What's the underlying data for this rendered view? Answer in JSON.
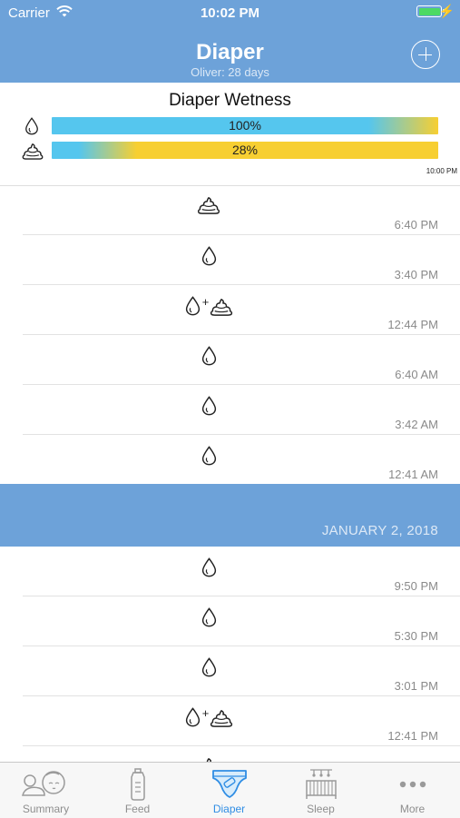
{
  "status_bar": {
    "carrier": "Carrier",
    "time": "10:02 PM"
  },
  "header": {
    "title": "Diaper",
    "subtitle": "Oliver: 28 days"
  },
  "wetness": {
    "title": "Diaper Wetness",
    "wet_percent": 100,
    "wet_label": "100%",
    "dirty_percent": 28,
    "dirty_label": "28%",
    "chart_time": "10:00 PM"
  },
  "entries_today": [
    {
      "type": "dirty",
      "time": "6:40 PM"
    },
    {
      "type": "wet",
      "time": "3:40 PM"
    },
    {
      "type": "both",
      "time": "12:44 PM"
    },
    {
      "type": "wet",
      "time": "6:40 AM"
    },
    {
      "type": "wet",
      "time": "3:42 AM"
    },
    {
      "type": "wet",
      "time": "12:41 AM"
    }
  ],
  "section_date": "JANUARY 2, 2018",
  "entries_jan2": [
    {
      "type": "wet",
      "time": "9:50 PM"
    },
    {
      "type": "wet",
      "time": "5:30 PM"
    },
    {
      "type": "wet",
      "time": "3:01 PM"
    },
    {
      "type": "both",
      "time": "12:41 PM"
    },
    {
      "type": "dirty",
      "time": ""
    }
  ],
  "tabs": [
    {
      "label": "Summary",
      "icon": "baby-face-icon"
    },
    {
      "label": "Feed",
      "icon": "bottle-icon"
    },
    {
      "label": "Diaper",
      "icon": "diaper-icon",
      "active": true
    },
    {
      "label": "Sleep",
      "icon": "crib-icon"
    },
    {
      "label": "More",
      "icon": "more-dots-icon"
    }
  ],
  "colors": {
    "header": "#6da2d9",
    "wet_bar": "#55c6ee",
    "dirty_bar": "#f7cf32",
    "tab_active": "#2f8de4",
    "tab_inactive": "#8e8e8e"
  }
}
